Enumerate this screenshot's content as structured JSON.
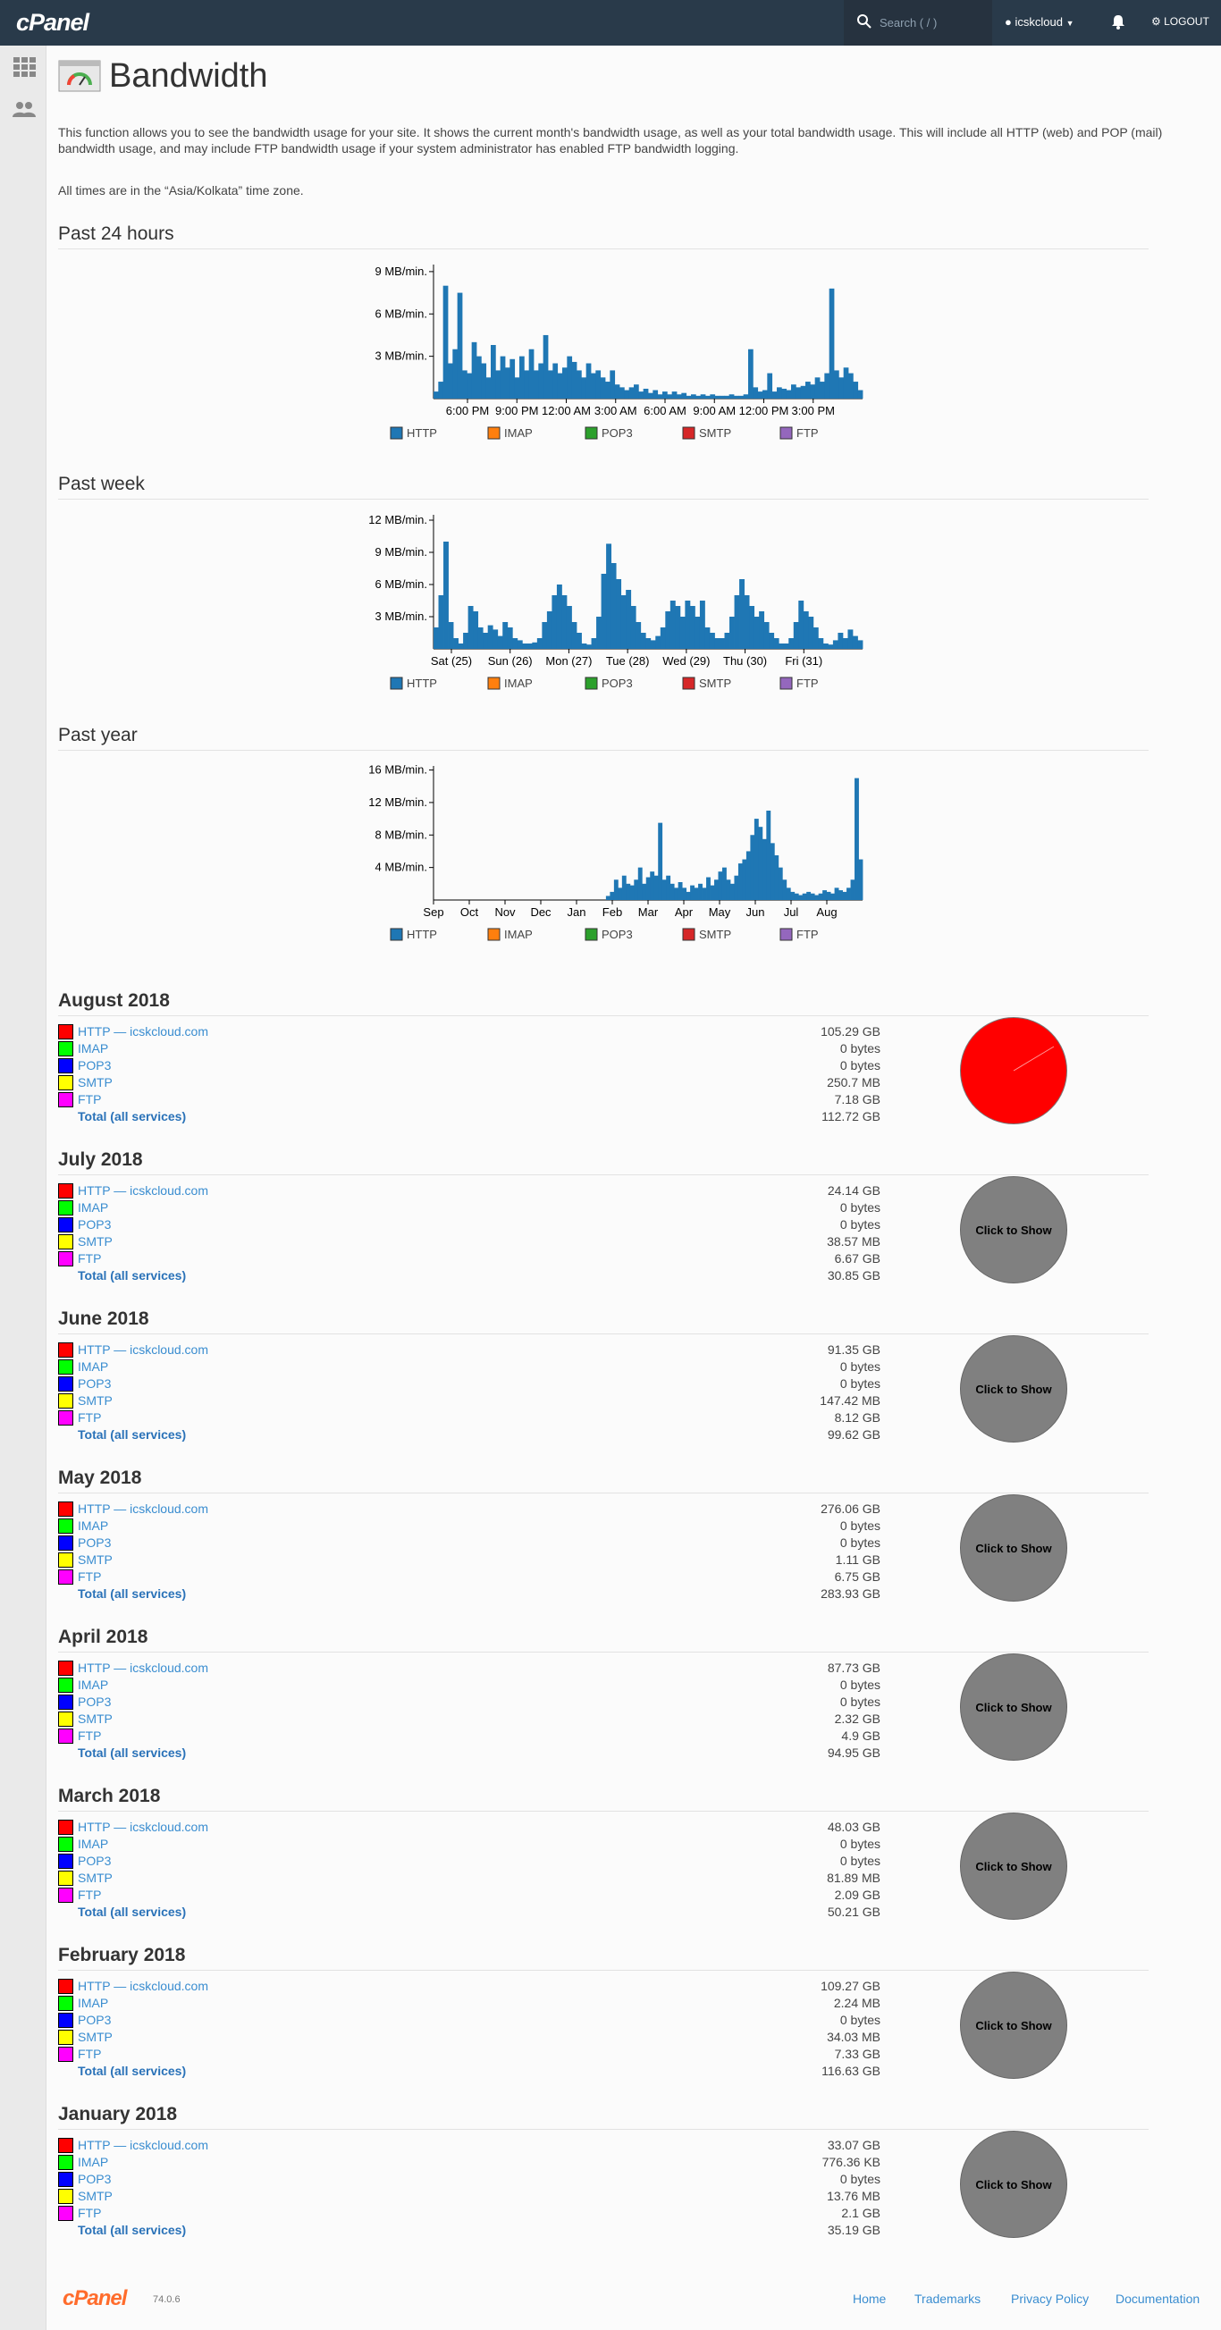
{
  "topbar": {
    "logo": "cPanel",
    "search_placeholder": "Search ( / )",
    "username": "icskcloud",
    "logout_label": "LOGOUT"
  },
  "page": {
    "title": "Bandwidth",
    "intro": "This function allows you to see the bandwidth usage for your site. It shows the current month's bandwidth usage, as well as your total bandwidth usage. This will include all HTTP (web) and POP (mail) bandwidth usage, and may include FTP bandwidth usage if your system administrator has enabled FTP bandwidth logging.",
    "timezone_note": "All times are in the “Asia/Kolkata” time zone."
  },
  "legend": [
    {
      "name": "HTTP",
      "color": "#1f77b4"
    },
    {
      "name": "IMAP",
      "color": "#ff7f0e"
    },
    {
      "name": "POP3",
      "color": "#2ca02c"
    },
    {
      "name": "SMTP",
      "color": "#d62728"
    },
    {
      "name": "FTP",
      "color": "#9467bd"
    }
  ],
  "chart_data": [
    {
      "type": "area",
      "title": "Past 24 hours",
      "y_ticks": [
        "3 MB/min.",
        "6 MB/min.",
        "9 MB/min."
      ],
      "y_max": 9.5,
      "x_ticks": [
        "6:00 PM",
        "9:00 PM",
        "12:00 AM",
        "3:00 AM",
        "6:00 AM",
        "9:00 AM",
        "12:00 PM",
        "3:00 PM"
      ],
      "series": [
        {
          "name": "HTTP",
          "values": [
            0.5,
            1.2,
            8.0,
            2.5,
            3.5,
            7.5,
            2.0,
            1.8,
            4.0,
            3.0,
            2.5,
            1.5,
            3.8,
            2.0,
            3.0,
            2.2,
            2.8,
            1.5,
            3.0,
            2.0,
            3.5,
            2.0,
            2.5,
            4.5,
            2.0,
            2.5,
            1.8,
            2.2,
            3.0,
            2.6,
            2.0,
            1.5,
            2.5,
            1.8,
            2.0,
            1.5,
            1.2,
            2.0,
            1.0,
            0.8,
            0.6,
            0.8,
            1.0,
            0.5,
            0.7,
            0.4,
            0.6,
            0.3,
            0.5,
            0.3,
            0.5,
            0.3,
            0.4,
            0.2,
            0.3,
            0.2,
            0.3,
            0.2,
            0.3,
            0.2,
            0.2,
            0.2,
            0.3,
            0.2,
            0.2,
            0.3,
            3.5,
            0.8,
            0.5,
            0.6,
            1.8,
            0.5,
            0.8,
            0.7,
            0.6,
            1.0,
            0.8,
            0.9,
            1.2,
            1.0,
            1.5,
            1.2,
            1.8,
            7.8,
            2.0,
            1.5,
            2.2,
            1.8,
            1.2,
            0.6
          ],
          "color": "#1f77b4"
        },
        {
          "name": "FTP",
          "values": [],
          "color": "#9467bd"
        }
      ]
    },
    {
      "type": "area",
      "title": "Past week",
      "y_ticks": [
        "3 MB/min.",
        "6 MB/min.",
        "9 MB/min.",
        "12 MB/min."
      ],
      "y_max": 12.5,
      "x_ticks": [
        "Sat (25)",
        "Sun (26)",
        "Mon (27)",
        "Tue (28)",
        "Wed (29)",
        "Thu (30)",
        "Fri (31)"
      ],
      "series": [
        {
          "name": "HTTP",
          "values": [
            2.0,
            5.0,
            10.0,
            2.5,
            1.0,
            0.5,
            1.5,
            4.0,
            3.5,
            2.0,
            1.5,
            2.2,
            1.8,
            1.2,
            2.5,
            2.0,
            1.0,
            0.8,
            0.5,
            0.5,
            0.6,
            1.0,
            2.5,
            3.5,
            5.0,
            6.0,
            5.0,
            4.0,
            2.5,
            1.5,
            0.5,
            0.4,
            1.0,
            3.0,
            7.0,
            9.8,
            8.0,
            6.5,
            5.0,
            5.5,
            4.0,
            2.5,
            1.5,
            1.0,
            0.8,
            1.2,
            2.0,
            3.5,
            4.5,
            4.0,
            3.0,
            4.5,
            4.0,
            3.0,
            4.5,
            2.0,
            1.5,
            1.0,
            1.0,
            1.5,
            3.0,
            5.0,
            6.5,
            5.0,
            4.0,
            3.0,
            3.5,
            2.5,
            1.5,
            1.0,
            0.5,
            0.5,
            1.0,
            2.5,
            4.5,
            3.5,
            3.0,
            2.0,
            1.0,
            0.5,
            0.4,
            0.8,
            1.5,
            1.0,
            1.8,
            1.2,
            0.8
          ],
          "color": "#1f77b4"
        },
        {
          "name": "FTP",
          "values": [],
          "color": "#9467bd"
        }
      ]
    },
    {
      "type": "area",
      "title": "Past year",
      "y_ticks": [
        "4 MB/min.",
        "8 MB/min.",
        "12 MB/min.",
        "16 MB/min."
      ],
      "y_max": 16.5,
      "x_ticks": [
        "Sep",
        "Oct",
        "Nov",
        "Dec",
        "Jan",
        "Feb",
        "Mar",
        "Apr",
        "May",
        "Jun",
        "Jul",
        "Aug"
      ],
      "series": [
        {
          "name": "HTTP",
          "values": [
            0,
            0,
            0,
            0,
            0,
            0,
            0,
            0,
            0,
            0,
            0,
            0,
            0,
            0,
            0,
            0,
            0,
            0,
            0,
            0,
            0,
            0,
            0,
            0,
            0,
            0,
            0,
            0,
            0,
            0,
            0,
            0,
            0,
            0,
            0,
            0,
            0,
            0,
            0,
            0,
            0,
            0,
            0,
            0.5,
            1.0,
            2.5,
            1.5,
            3.0,
            2.0,
            1.8,
            2.5,
            4.0,
            2.0,
            2.8,
            3.5,
            3.0,
            9.5,
            2.5,
            3.0,
            2.0,
            1.5,
            2.2,
            1.5,
            1.0,
            1.8,
            1.5,
            2.0,
            1.5,
            2.8,
            1.8,
            2.5,
            3.5,
            4.0,
            2.5,
            2.0,
            3.0,
            4.5,
            5.0,
            6.0,
            8.0,
            10.0,
            9.0,
            7.5,
            11.0,
            7.0,
            5.5,
            4.0,
            2.5,
            1.5,
            1.0,
            0.8,
            0.6,
            0.8,
            1.0,
            0.8,
            0.6,
            0.8,
            1.2,
            1.0,
            0.8,
            1.5,
            1.2,
            1.0,
            1.5,
            2.5,
            15.0,
            5.0
          ],
          "color": "#1f77b4"
        },
        {
          "name": "FTP",
          "values": [],
          "color": "#9467bd"
        }
      ]
    }
  ],
  "months": [
    {
      "title": "August 2018",
      "http_label": "HTTP — icskcloud.com",
      "values": [
        "105.29 GB",
        "0 bytes",
        "0 bytes",
        "250.7 MB",
        "7.18 GB",
        "112.72 GB"
      ],
      "pie_shown": true
    },
    {
      "title": "July 2018",
      "http_label": "HTTP — icskcloud.com",
      "values": [
        "24.14 GB",
        "0 bytes",
        "0 bytes",
        "38.57 MB",
        "6.67 GB",
        "30.85 GB"
      ],
      "pie_shown": false
    },
    {
      "title": "June 2018",
      "http_label": "HTTP — icskcloud.com",
      "values": [
        "91.35 GB",
        "0 bytes",
        "0 bytes",
        "147.42 MB",
        "8.12 GB",
        "99.62 GB"
      ],
      "pie_shown": false
    },
    {
      "title": "May 2018",
      "http_label": "HTTP — icskcloud.com",
      "values": [
        "276.06 GB",
        "0 bytes",
        "0 bytes",
        "1.11 GB",
        "6.75 GB",
        "283.93 GB"
      ],
      "pie_shown": false
    },
    {
      "title": "April 2018",
      "http_label": "HTTP — icskcloud.com",
      "values": [
        "87.73 GB",
        "0 bytes",
        "0 bytes",
        "2.32 GB",
        "4.9 GB",
        "94.95 GB"
      ],
      "pie_shown": false
    },
    {
      "title": "March 2018",
      "http_label": "HTTP — icskcloud.com",
      "values": [
        "48.03 GB",
        "0 bytes",
        "0 bytes",
        "81.89 MB",
        "2.09 GB",
        "50.21 GB"
      ],
      "pie_shown": false
    },
    {
      "title": "February 2018",
      "http_label": "HTTP — icskcloud.com",
      "values": [
        "109.27 GB",
        "2.24 MB",
        "0 bytes",
        "34.03 MB",
        "7.33 GB",
        "116.63 GB"
      ],
      "pie_shown": false
    },
    {
      "title": "January 2018",
      "http_label": "HTTP — icskcloud.com",
      "values": [
        "33.07 GB",
        "776.36 KB",
        "0 bytes",
        "13.76 MB",
        "2.1 GB",
        "35.19 GB"
      ],
      "pie_shown": false
    }
  ],
  "row_labels": [
    "IMAP",
    "POP3",
    "SMTP",
    "FTP",
    "Total (all services)"
  ],
  "row_colors": [
    "#ff0000",
    "#00ff00",
    "#0000ff",
    "#ffff00",
    "#ff00ff"
  ],
  "pie_button_label": "Click to Show",
  "footer": {
    "logo": "cPanel",
    "version": "74.0.6",
    "links": [
      "Home",
      "Trademarks",
      "Privacy Policy",
      "Documentation"
    ]
  }
}
